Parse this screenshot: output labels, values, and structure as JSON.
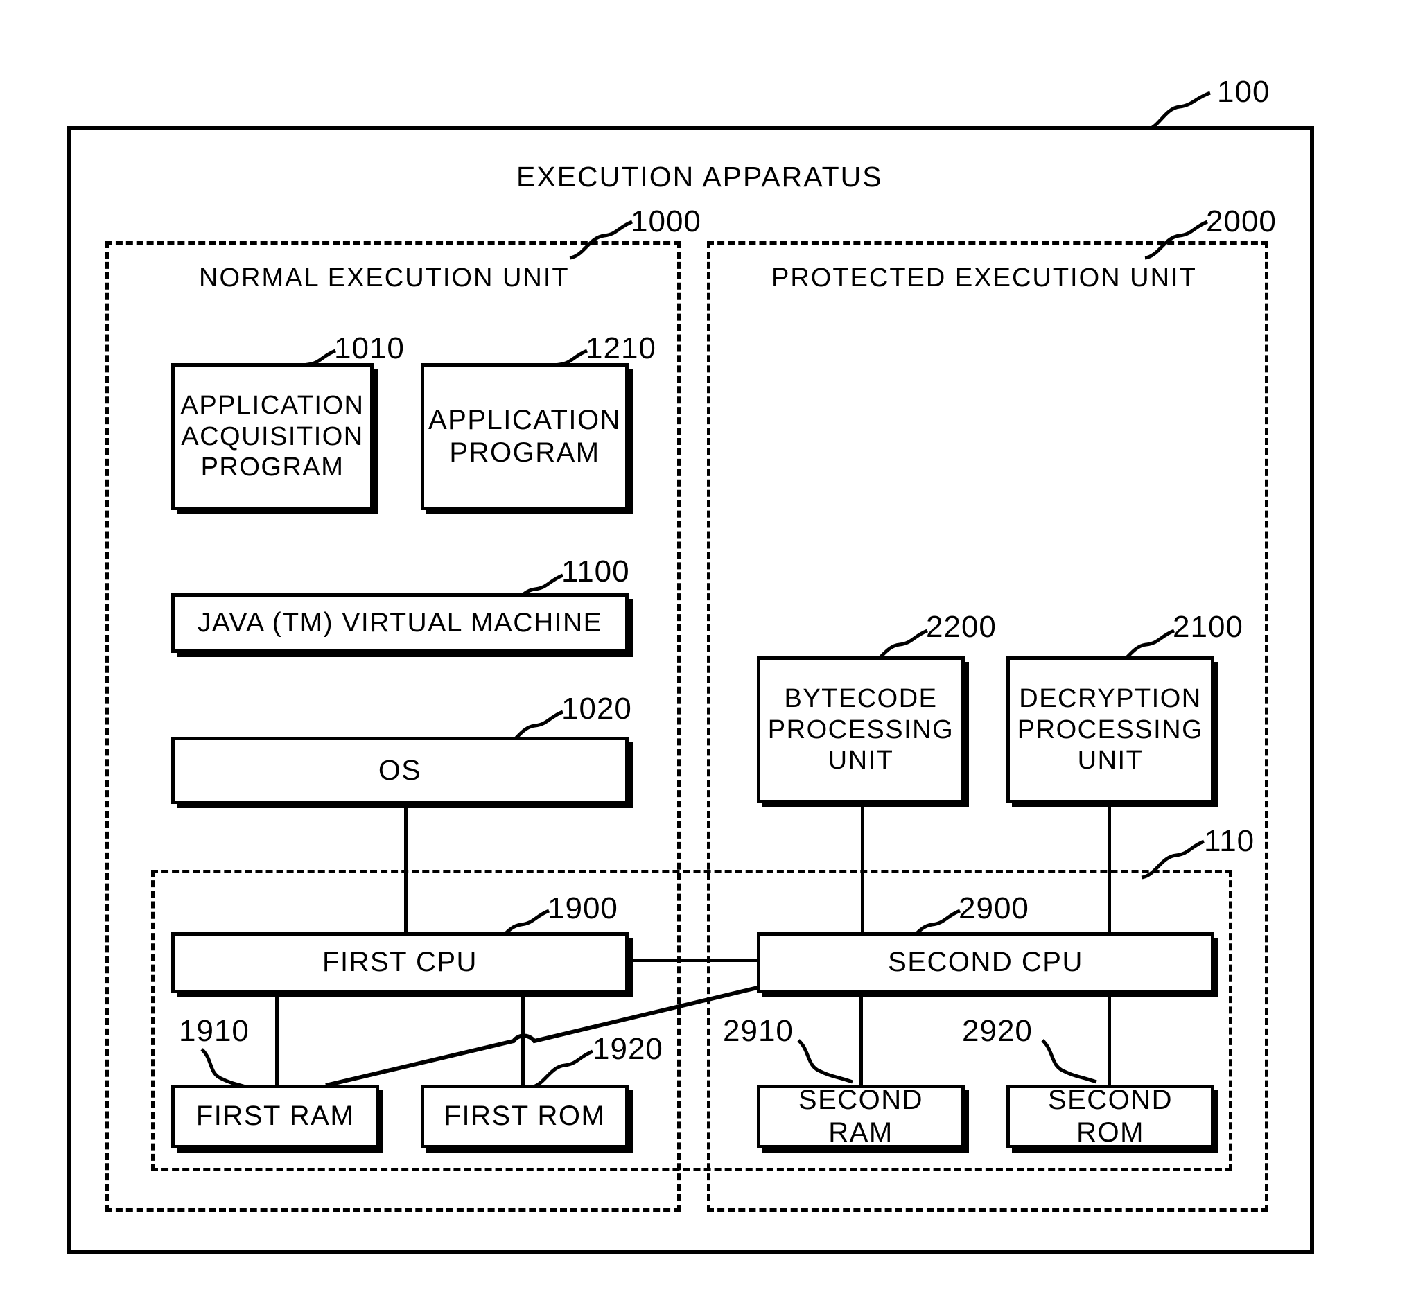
{
  "figure": {
    "title": "EXECUTION APPARATUS",
    "apparatus_ref": "100",
    "hardware_ref": "110"
  },
  "units": {
    "normal": {
      "label": "NORMAL EXECUTION UNIT",
      "ref": "1000"
    },
    "protected": {
      "label": "PROTECTED EXECUTION UNIT",
      "ref": "2000"
    }
  },
  "nodes": {
    "app_acquisition": {
      "label": "APPLICATION ACQUISITION PROGRAM",
      "ref": "1010"
    },
    "app_program": {
      "label": "APPLICATION PROGRAM",
      "ref": "1210"
    },
    "jvm": {
      "label": "JAVA (TM) VIRTUAL MACHINE",
      "ref": "1100"
    },
    "os": {
      "label": "OS",
      "ref": "1020"
    },
    "bytecode_unit": {
      "label": "BYTECODE PROCESSING UNIT",
      "ref": "2200"
    },
    "decryption_unit": {
      "label": "DECRYPTION PROCESSING UNIT",
      "ref": "2100"
    },
    "first_cpu": {
      "label": "FIRST CPU",
      "ref": "1900"
    },
    "first_ram": {
      "label": "FIRST RAM",
      "ref": "1910"
    },
    "first_rom": {
      "label": "FIRST ROM",
      "ref": "1920"
    },
    "second_cpu": {
      "label": "SECOND CPU",
      "ref": "2900"
    },
    "second_ram": {
      "label": "SECOND RAM",
      "ref": "2910"
    },
    "second_rom": {
      "label": "SECOND ROM",
      "ref": "2920"
    }
  },
  "colors": {
    "ink": "#000000",
    "paper": "#ffffff"
  }
}
